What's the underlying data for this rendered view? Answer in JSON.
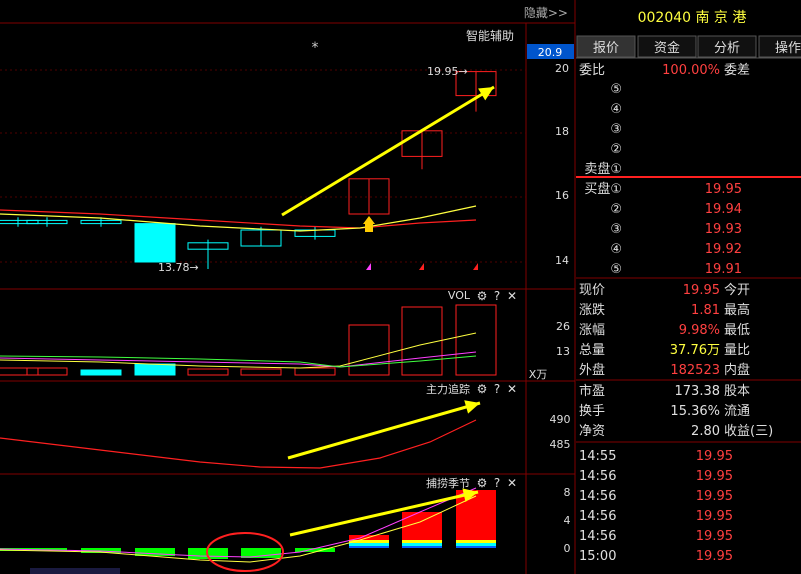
{
  "header": {
    "hide_label": "隐藏>>",
    "smart_assist": "智能辅助",
    "star": "*"
  },
  "stock": {
    "code": "002040",
    "name": "南 京 港"
  },
  "tabs": [
    {
      "label": "报价",
      "active": true
    },
    {
      "label": "资金",
      "active": false
    },
    {
      "label": "分析",
      "active": false
    },
    {
      "label": "操作",
      "active": false
    }
  ],
  "price_axis": {
    "current_box": "20.9",
    "ticks": [
      "20",
      "18",
      "16",
      "14"
    ]
  },
  "annotations": {
    "high": "19.95→",
    "low": "13.78→"
  },
  "vol": {
    "title": "VOL",
    "ticks": [
      "26",
      "13"
    ],
    "unit": "X万"
  },
  "zhuli": {
    "title": "主力追踪",
    "ticks": [
      "490",
      "485"
    ]
  },
  "bushou": {
    "title": "捕捞季节",
    "ticks": [
      "8",
      "4",
      "0"
    ]
  },
  "panel_icons": {
    "gear": "⚙",
    "help": "?",
    "close": "✕"
  },
  "order_book": {
    "weibi_label": "委比",
    "weibi_value": "100.00%",
    "weicha_label": "委差",
    "sell": [
      {
        "label": "⑤",
        "price": ""
      },
      {
        "label": "④",
        "price": ""
      },
      {
        "label": "③",
        "price": ""
      },
      {
        "label": "②",
        "price": ""
      },
      {
        "label": "卖盘①",
        "price": ""
      }
    ],
    "buy": [
      {
        "label": "买盘①",
        "price": "19.95"
      },
      {
        "label": "②",
        "price": "19.94"
      },
      {
        "label": "③",
        "price": "19.93"
      },
      {
        "label": "④",
        "price": "19.92"
      },
      {
        "label": "⑤",
        "price": "19.91"
      }
    ]
  },
  "quote": [
    {
      "label": "现价",
      "value": "19.95",
      "label2": "今开",
      "cls": "red"
    },
    {
      "label": "涨跌",
      "value": "1.81",
      "label2": "最高",
      "cls": "red"
    },
    {
      "label": "涨幅",
      "value": "9.98%",
      "label2": "最低",
      "cls": "red"
    },
    {
      "label": "总量",
      "value": "37.76万",
      "label2": "量比",
      "cls": "yel"
    },
    {
      "label": "外盘",
      "value": "182523",
      "label2": "内盘",
      "cls": "red"
    }
  ],
  "fundamentals": [
    {
      "label": "市盈",
      "value": "173.38",
      "label2": "股本"
    },
    {
      "label": "换手",
      "value": "15.36%",
      "label2": "流通"
    },
    {
      "label": "净资",
      "value": "2.80",
      "label2": "收益(三)"
    }
  ],
  "ticks_list": [
    {
      "time": "14:55",
      "price": "19.95"
    },
    {
      "time": "14:56",
      "price": "19.95"
    },
    {
      "time": "14:56",
      "price": "19.95"
    },
    {
      "time": "14:56",
      "price": "19.95"
    },
    {
      "time": "14:56",
      "price": "19.95"
    },
    {
      "time": "15:00",
      "price": "19.95"
    }
  ],
  "chart_data": {
    "type": "candlestick",
    "price_axis_ticks": [
      14,
      16,
      18,
      20
    ],
    "candles": [
      {
        "open": 15.3,
        "close": 15.2,
        "high": 15.4,
        "low": 15.1
      },
      {
        "open": 15.3,
        "close": 15.2,
        "high": 15.4,
        "low": 15.1
      },
      {
        "open": 15.3,
        "close": 15.2,
        "high": 15.4,
        "low": 15.1
      },
      {
        "open": 15.2,
        "close": 14.0,
        "high": 15.2,
        "low": 14.0
      },
      {
        "open": 14.6,
        "close": 14.4,
        "high": 14.7,
        "low": 13.78
      },
      {
        "open": 15.0,
        "close": 14.5,
        "high": 15.1,
        "low": 14.5
      },
      {
        "open": 15.0,
        "close": 14.8,
        "high": 15.1,
        "low": 14.7
      },
      {
        "open": 15.5,
        "close": 16.6,
        "high": 16.6,
        "low": 15.5
      },
      {
        "open": 17.3,
        "close": 18.1,
        "high": 18.1,
        "low": 16.9
      },
      {
        "open": 19.2,
        "close": 19.95,
        "high": 19.95,
        "low": 18.7
      }
    ]
  }
}
